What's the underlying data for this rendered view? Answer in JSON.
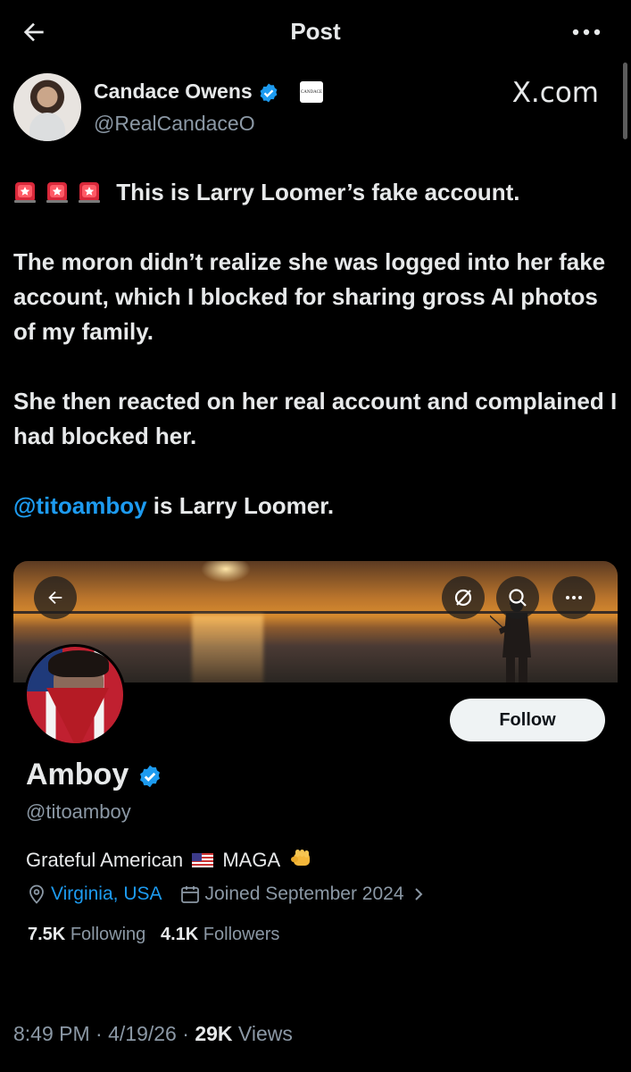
{
  "header": {
    "title": "Post",
    "back_icon": "arrow-left-icon",
    "more_icon": "more-horizontal-icon"
  },
  "author": {
    "name": "Candace Owens",
    "handle": "@RealCandaceO",
    "affiliation_badge_text": "CANDACE",
    "source": "X.com"
  },
  "tweet": {
    "line1": "This is Larry Loomer’s fake account.",
    "para2": "The moron didn’t realize she was logged into her fake account, which I blocked for sharing gross AI photos of my family.",
    "para3": "She then reacted on her real account and complained I had blocked her.",
    "mention": "@titoamboy",
    "para4_rest": " is Larry Loomer.",
    "emoji": [
      "siren-icon",
      "siren-icon",
      "siren-icon"
    ]
  },
  "profile_card": {
    "name": "Amboy",
    "handle": "@titoamboy",
    "follow_label": "Follow",
    "bio_part1": "Grateful American",
    "bio_part2": "MAGA",
    "location": "Virginia, USA",
    "joined": "Joined September 2024",
    "following_count": "7.5K",
    "following_label": "Following",
    "followers_count": "4.1K",
    "followers_label": "Followers"
  },
  "footer": {
    "time": "8:49 PM",
    "date": "4/19/26",
    "views_count": "29K",
    "views_label": "Views"
  },
  "colors": {
    "background": "#000000",
    "text": "#e7e9ea",
    "secondary": "#8b98a5",
    "link": "#1d9bf0"
  }
}
